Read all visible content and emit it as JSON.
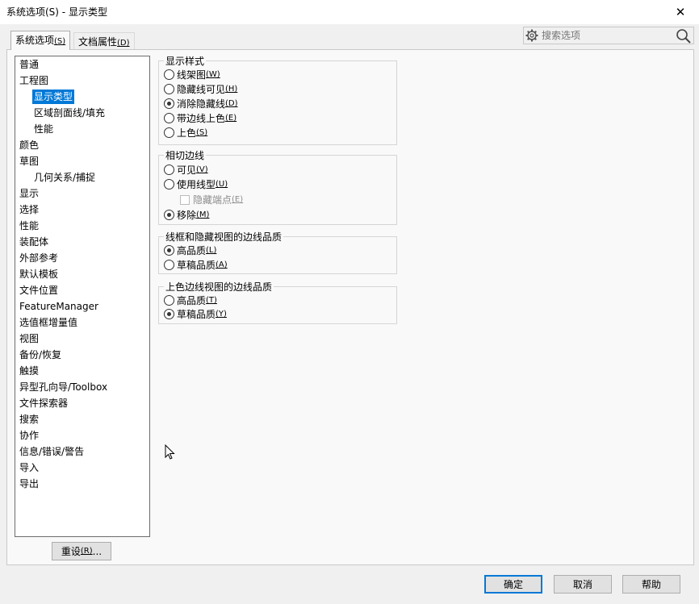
{
  "window": {
    "title": "系统选项(S) - 显示类型",
    "close_glyph": "✕"
  },
  "tabs": [
    {
      "label": "系统选项",
      "mnemonic": "(S)",
      "active": true
    },
    {
      "label": "文档属性",
      "mnemonic": "(D)",
      "active": false
    }
  ],
  "search": {
    "placeholder": "搜索选项"
  },
  "nav": {
    "items": [
      {
        "label": "普通",
        "level": 0
      },
      {
        "label": "工程图",
        "level": 0
      },
      {
        "label": "显示类型",
        "level": 1,
        "selected": true
      },
      {
        "label": "区域剖面线/填充",
        "level": 1
      },
      {
        "label": "性能",
        "level": 1
      },
      {
        "label": "颜色",
        "level": 0
      },
      {
        "label": "草图",
        "level": 0
      },
      {
        "label": "几何关系/捕捉",
        "level": 1
      },
      {
        "label": "显示",
        "level": 0
      },
      {
        "label": "选择",
        "level": 0
      },
      {
        "label": "性能",
        "level": 0
      },
      {
        "label": "装配体",
        "level": 0
      },
      {
        "label": "外部参考",
        "level": 0
      },
      {
        "label": "默认模板",
        "level": 0
      },
      {
        "label": "文件位置",
        "level": 0
      },
      {
        "label": "FeatureManager",
        "level": 0
      },
      {
        "label": "选值框增量值",
        "level": 0
      },
      {
        "label": "视图",
        "level": 0
      },
      {
        "label": "备份/恢复",
        "level": 0
      },
      {
        "label": "触摸",
        "level": 0
      },
      {
        "label": "异型孔向导/Toolbox",
        "level": 0
      },
      {
        "label": "文件探索器",
        "level": 0
      },
      {
        "label": "搜索",
        "level": 0
      },
      {
        "label": "协作",
        "level": 0
      },
      {
        "label": "信息/错误/警告",
        "level": 0
      },
      {
        "label": "导入",
        "level": 0
      },
      {
        "label": "导出",
        "level": 0
      }
    ]
  },
  "reset_button": {
    "label": "重设",
    "mnemonic": "(R)",
    "suffix": "..."
  },
  "groups": {
    "display_style": {
      "title": "显示样式",
      "options": [
        {
          "label": "线架图",
          "mnemonic": "(W)",
          "checked": false
        },
        {
          "label": "隐藏线可见",
          "mnemonic": "(H)",
          "checked": false
        },
        {
          "label": "消除隐藏线",
          "mnemonic": "(D)",
          "checked": true
        },
        {
          "label": "带边线上色",
          "mnemonic": "(E)",
          "checked": false
        },
        {
          "label": "上色",
          "mnemonic": "(S)",
          "checked": false
        }
      ]
    },
    "tangent_edges": {
      "title": "相切边线",
      "options": [
        {
          "label": "可见",
          "mnemonic": "(V)",
          "checked": false
        },
        {
          "label": "使用线型",
          "mnemonic": "(U)",
          "checked": false
        },
        {
          "label": "移除",
          "mnemonic": "(M)",
          "checked": true
        }
      ],
      "sub_checkbox": {
        "label": "隐藏端点",
        "mnemonic": "(E)",
        "checked": false,
        "disabled": true
      }
    },
    "wireframe_quality": {
      "title": "线框和隐藏视图的边线品质",
      "options": [
        {
          "label": "高品质",
          "mnemonic": "(L)",
          "checked": true
        },
        {
          "label": "草稿品质",
          "mnemonic": "(A)",
          "checked": false
        }
      ]
    },
    "shaded_quality": {
      "title": "上色边线视图的边线品质",
      "options": [
        {
          "label": "高品质",
          "mnemonic": "(T)",
          "checked": false
        },
        {
          "label": "草稿品质",
          "mnemonic": "(Y)",
          "checked": true
        }
      ]
    }
  },
  "footer": {
    "ok": "确定",
    "cancel": "取消",
    "help": "帮助"
  }
}
